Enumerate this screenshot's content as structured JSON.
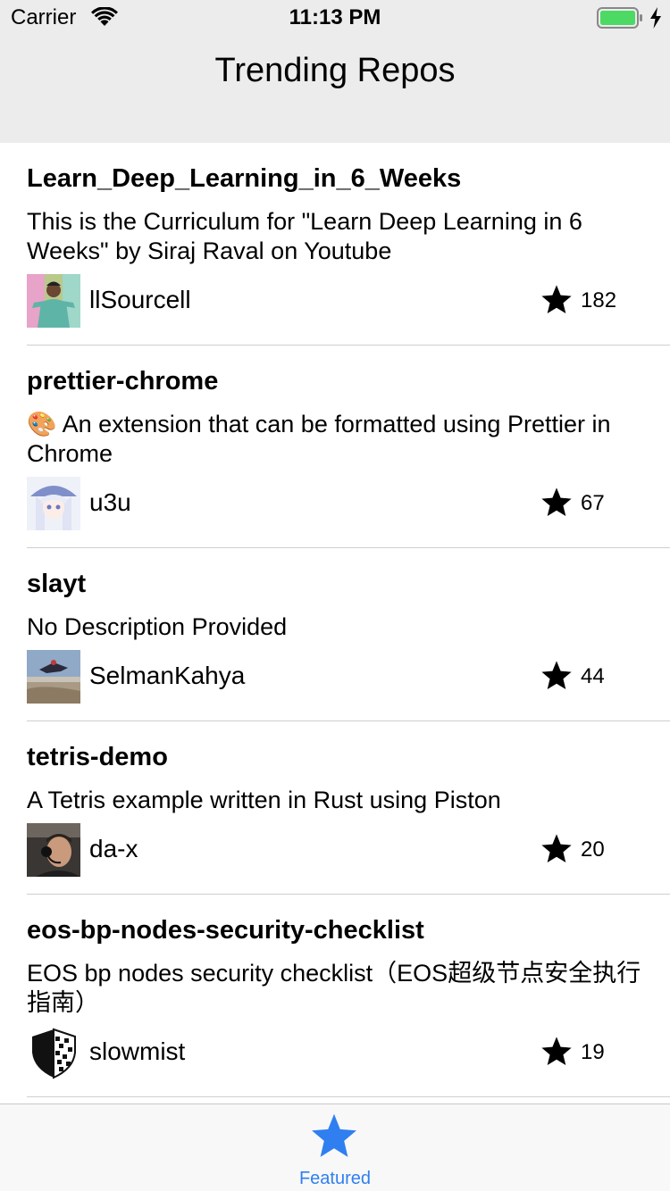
{
  "status_bar": {
    "carrier": "Carrier",
    "time": "11:13 PM",
    "battery_color": "#4cd964"
  },
  "nav": {
    "title": "Trending Repos"
  },
  "repos": [
    {
      "name": "Learn_Deep_Learning_in_6_Weeks",
      "description": "This is the Curriculum for \"Learn Deep Learning in 6 Weeks\" by Siraj Raval on Youtube",
      "owner": "llSourcell",
      "stars": "182",
      "avatar_icon": "person-photo-avatar"
    },
    {
      "name": "prettier-chrome",
      "description": "🎨 An extension that can be formatted using Prettier in Chrome",
      "owner": "u3u",
      "stars": "67",
      "avatar_icon": "anime-girl-avatar"
    },
    {
      "name": "slayt",
      "description": "No Description Provided",
      "owner": "SelmanKahya",
      "stars": "44",
      "avatar_icon": "skydiver-photo-avatar"
    },
    {
      "name": "tetris-demo",
      "description": "A Tetris example written in Rust using Piston",
      "owner": "da-x",
      "stars": "20",
      "avatar_icon": "person-headset-avatar"
    },
    {
      "name": "eos-bp-nodes-security-checklist",
      "description": "EOS bp nodes security checklist（EOS超级节点安全执行指南）",
      "owner": "slowmist",
      "stars": "19",
      "avatar_icon": "shield-logo-avatar"
    }
  ],
  "tabbar": {
    "featured_label": "Featured",
    "accent_color": "#2f7ff0"
  }
}
